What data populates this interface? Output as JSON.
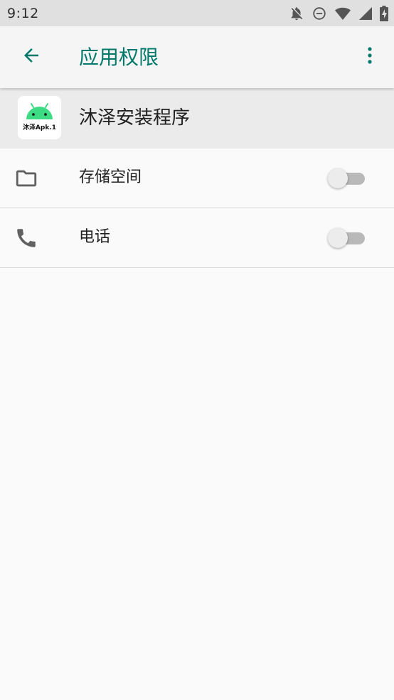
{
  "status_bar": {
    "time": "9:12",
    "icons": [
      "notifications-off-icon",
      "do-not-disturb-icon",
      "wifi-icon",
      "cellular-signal-icon",
      "battery-charging-icon"
    ]
  },
  "app_bar": {
    "back_icon": "arrow-back-icon",
    "title": "应用权限",
    "overflow_icon": "more-vert-icon"
  },
  "app_header": {
    "name": "沐泽安装程序",
    "icon_text": "沐泽Apk.1",
    "icon_color": "#3ddc84"
  },
  "permissions": [
    {
      "icon": "folder-icon",
      "label": "存储空间",
      "enabled": false
    },
    {
      "icon": "phone-icon",
      "label": "电话",
      "enabled": false
    }
  ],
  "colors": {
    "accent": "#00796b",
    "status_bar_bg": "#e0e0e0",
    "app_bar_bg": "#f5f5f5",
    "header_bg": "#ebebeb",
    "page_bg": "#fafafa"
  }
}
